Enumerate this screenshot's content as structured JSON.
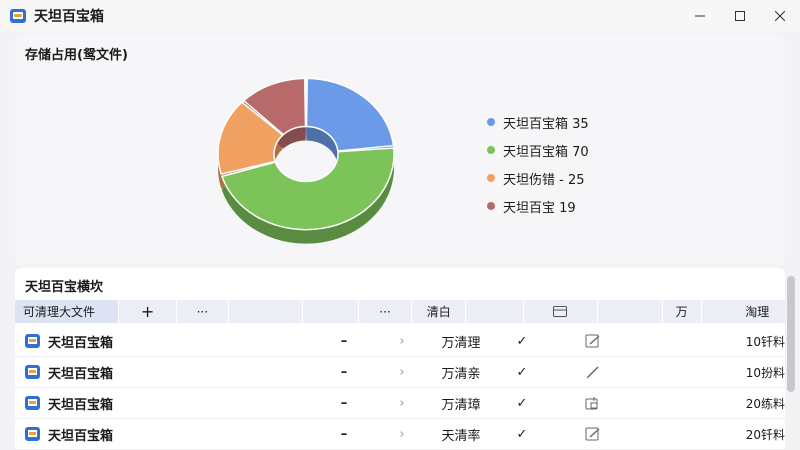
{
  "window": {
    "title": "天坦百宝箱",
    "controls": [
      "minimize-icon",
      "maximize-icon",
      "close-icon"
    ]
  },
  "storage": {
    "title": "存储占用(鸳文件)"
  },
  "chart_data": {
    "type": "pie",
    "categories": [
      "天坦百宝箱 35",
      "天坦百宝箱 70",
      "天坦伤错 - 25",
      "天坦百宝 19"
    ],
    "values": [
      35,
      70,
      25,
      19
    ],
    "colors": [
      "#6b9be8",
      "#7cc35a",
      "#f0a060",
      "#b86a6a"
    ],
    "legend_position": "right"
  },
  "module": {
    "title": "天坦百宝横坎",
    "headers": {
      "col1": "可清理大文件",
      "col2": "+",
      "col3": "···",
      "col6": "···",
      "col7": "清白",
      "col10": "万",
      "col11": "淘理"
    },
    "rows": [
      {
        "name": "天坦百宝箱",
        "dash": "–",
        "chev": "›",
        "status": "万清理",
        "check": "✓",
        "size": "10钎料"
      },
      {
        "name": "天坦百宝箱",
        "dash": "–",
        "chev": "›",
        "status": "万清亲",
        "check": "✓",
        "size": "10扮料"
      },
      {
        "name": "天坦百宝箱",
        "dash": "–",
        "chev": "›",
        "status": "万清璋",
        "check": "✓",
        "size": "20练料"
      },
      {
        "name": "天坦百宝箱",
        "dash": "–",
        "chev": "›",
        "status": "天清率",
        "check": "✓",
        "size": "20钎料"
      }
    ]
  }
}
